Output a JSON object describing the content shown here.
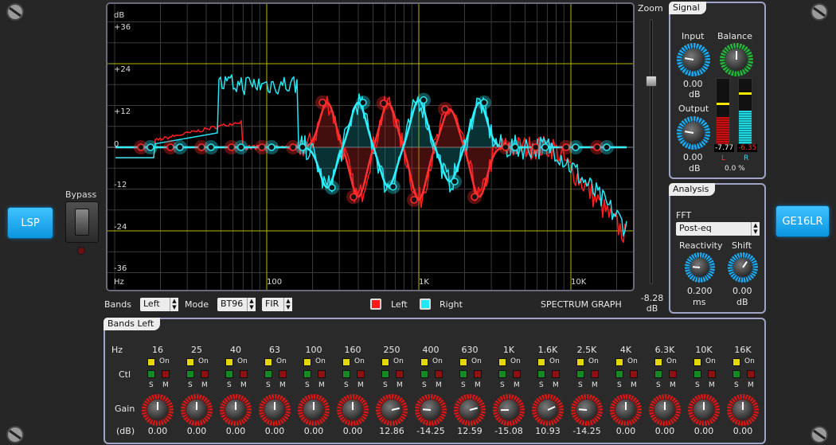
{
  "left_button": "LSP",
  "right_button": "GE16LR",
  "bypass": {
    "label": "Bypass"
  },
  "zoom": {
    "label": "Zoom",
    "value": "-8.28",
    "unit": "dB"
  },
  "graph": {
    "db_unit": "dB",
    "hz_unit": "Hz",
    "db_ticks": [
      "+36",
      "+24",
      "+12",
      "0",
      "-12",
      "-24",
      "-36"
    ],
    "freq_ticks": [
      "100",
      "1K",
      "10K"
    ],
    "title": "SPECTRUM GRAPH"
  },
  "controls": {
    "bands_label": "Bands",
    "bands_value": "Left",
    "mode_label": "Mode",
    "mode_value": "BT96",
    "filter_value": "FIR",
    "legend_left": "Left",
    "legend_right": "Right"
  },
  "signal": {
    "title": "Signal",
    "input_label": "Input",
    "input_value": "0.00",
    "input_unit": "dB",
    "balance_label": "Balance",
    "output_label": "Output",
    "output_value": "0.00",
    "output_unit": "dB",
    "meter_left_value": "-7.77",
    "meter_right_value": "-6.35",
    "meter_left_label": "L",
    "meter_right_label": "R",
    "balance_value": "0.0 %",
    "meter_left_level": 0.45,
    "meter_right_level": 0.55
  },
  "analysis": {
    "title": "Analysis",
    "fft_label": "FFT",
    "fft_value": "Post-eq",
    "reactivity_label": "Reactivity",
    "reactivity_value": "0.200",
    "reactivity_unit": "ms",
    "shift_label": "Shift",
    "shift_value": "0.00",
    "shift_unit": "dB"
  },
  "bands": {
    "title": "Bands Left",
    "hz_label": "Hz",
    "ctl_label": "Ctl",
    "gain_label": "Gain",
    "db_label": "(dB)",
    "on_label": "On",
    "s_label": "S",
    "m_label": "M",
    "frequencies": [
      "16",
      "25",
      "40",
      "63",
      "100",
      "160",
      "250",
      "400",
      "630",
      "1K",
      "1.6K",
      "2.5K",
      "4K",
      "6.3K",
      "10K",
      "16K"
    ],
    "gains": [
      "0.00",
      "0.00",
      "0.00",
      "0.00",
      "0.00",
      "0.00",
      "12.86",
      "-14.25",
      "12.59",
      "-15.08",
      "10.93",
      "-14.25",
      "0.00",
      "0.00",
      "0.00",
      "0.00"
    ]
  },
  "colors": {
    "left": "#ff2a2a",
    "right": "#27e4f0",
    "accent": "#1aa8ef"
  }
}
